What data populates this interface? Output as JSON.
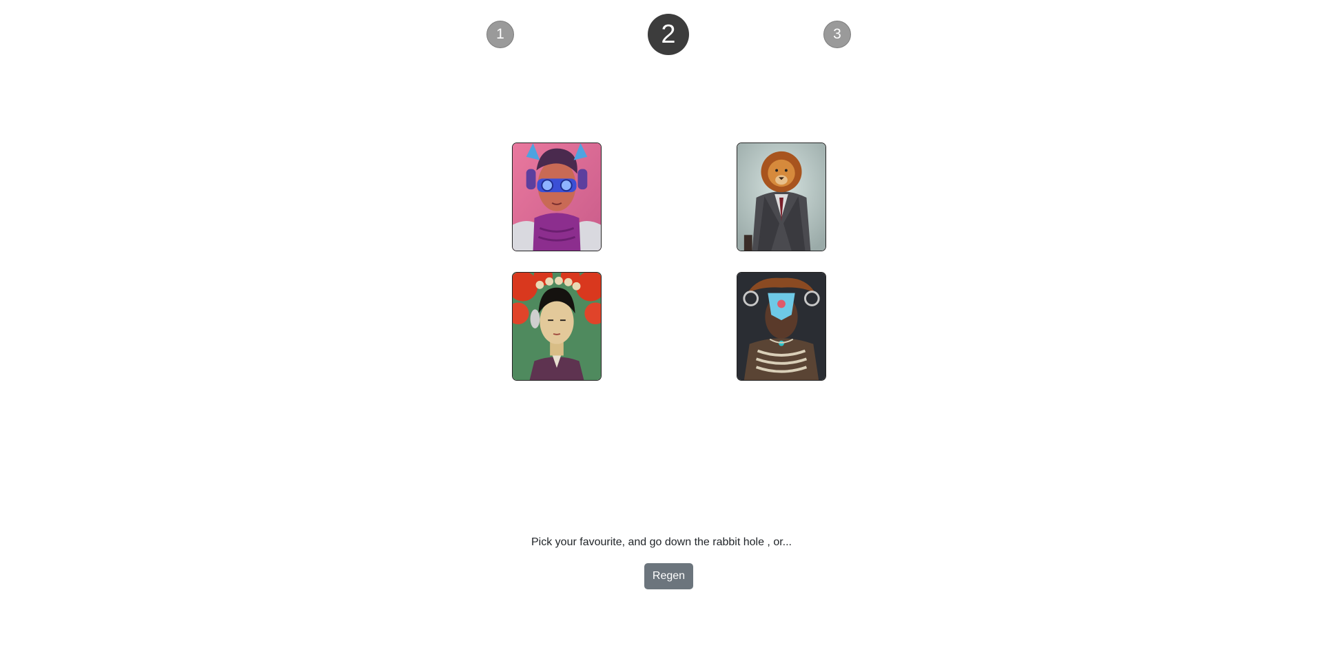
{
  "steps": [
    {
      "label": "1",
      "active": false
    },
    {
      "label": "2",
      "active": true
    },
    {
      "label": "3",
      "active": false
    }
  ],
  "gallery": {
    "images": [
      {
        "subject": "portrait-goggles-headphones"
      },
      {
        "subject": "portrait-lion-suit"
      },
      {
        "subject": "portrait-flower-headdress"
      },
      {
        "subject": "portrait-ornate-headdress"
      }
    ]
  },
  "footer": {
    "prompt_text": "Pick your favourite, and go down the rabbit hole , or...",
    "regen_label": "Regen"
  },
  "colors": {
    "step_inactive": "#9a9a9a",
    "step_active": "#3c3c3c",
    "button_secondary": "#6c757d"
  }
}
